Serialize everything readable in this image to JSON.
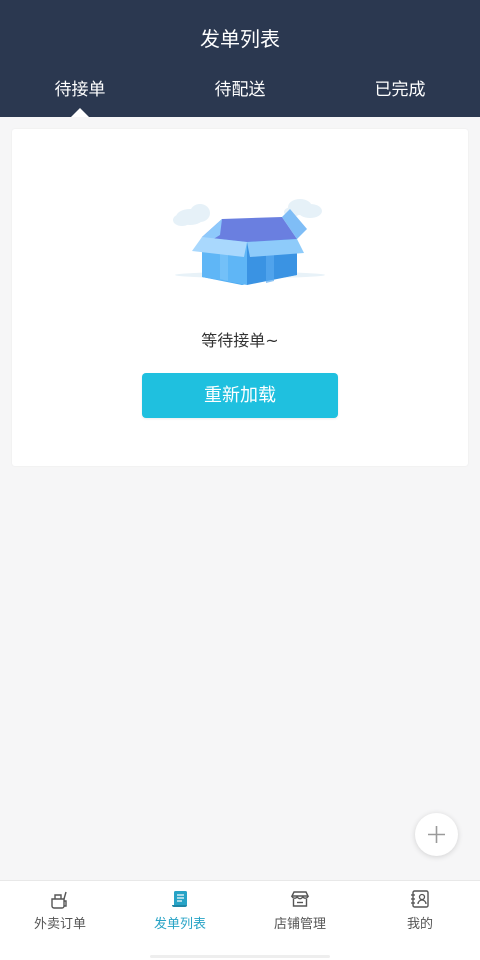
{
  "header": {
    "title": "发单列表",
    "tabs": [
      {
        "label": "待接单",
        "active": true
      },
      {
        "label": "待配送",
        "active": false
      },
      {
        "label": "已完成",
        "active": false
      }
    ]
  },
  "empty_state": {
    "message": "等待接单~",
    "reload_label": "重新加载",
    "icon": "open-box-illustration"
  },
  "fab": {
    "icon": "plus-icon"
  },
  "bottom_nav": {
    "items": [
      {
        "label": "外卖订单",
        "icon": "takeout-icon",
        "active": false
      },
      {
        "label": "发单列表",
        "icon": "scroll-icon",
        "active": true
      },
      {
        "label": "店铺管理",
        "icon": "store-icon",
        "active": false
      },
      {
        "label": "我的",
        "icon": "profile-icon",
        "active": false
      }
    ]
  },
  "colors": {
    "header_bg": "#2b3850",
    "accent": "#1fc0df",
    "active_nav": "#27a3c6",
    "page_bg": "#f6f6f7"
  }
}
